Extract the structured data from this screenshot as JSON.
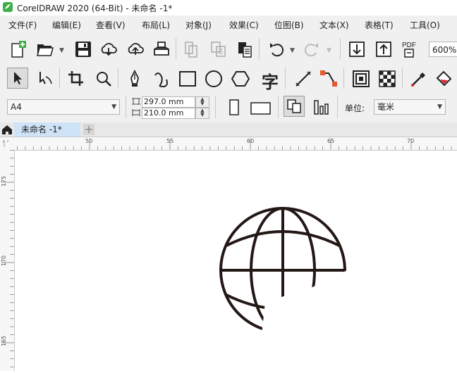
{
  "window": {
    "title": "CorelDRAW 2020 (64-Bit) - 未命名 -1*"
  },
  "menu": {
    "items": [
      "文件(F)",
      "编辑(E)",
      "查看(V)",
      "布局(L)",
      "对象(J)",
      "效果(C)",
      "位图(B)",
      "文本(X)",
      "表格(T)",
      "工具(O)"
    ]
  },
  "toolbar": {
    "zoom": "600%",
    "pdf_label": "PDF"
  },
  "toolbox": {
    "text_tool_glyph": "字"
  },
  "property_bar": {
    "page_size": "A4",
    "width": "297.0 mm",
    "height": "210.0 mm",
    "units_label": "单位:",
    "units_value": "毫米"
  },
  "tabs": {
    "document_tab": "未命名 -1*",
    "add_tab": "+"
  },
  "rulers": {
    "horizontal_ticks": [
      "50",
      "55",
      "60",
      "65",
      "70"
    ],
    "vertical_ticks": [
      "175",
      "170",
      "165"
    ]
  },
  "colors": {
    "accent_tab": "#cfe3f7",
    "shape_stroke": "#231815",
    "app_logo": "#3fae49"
  },
  "canvas": {
    "shape": "globe-icon"
  }
}
